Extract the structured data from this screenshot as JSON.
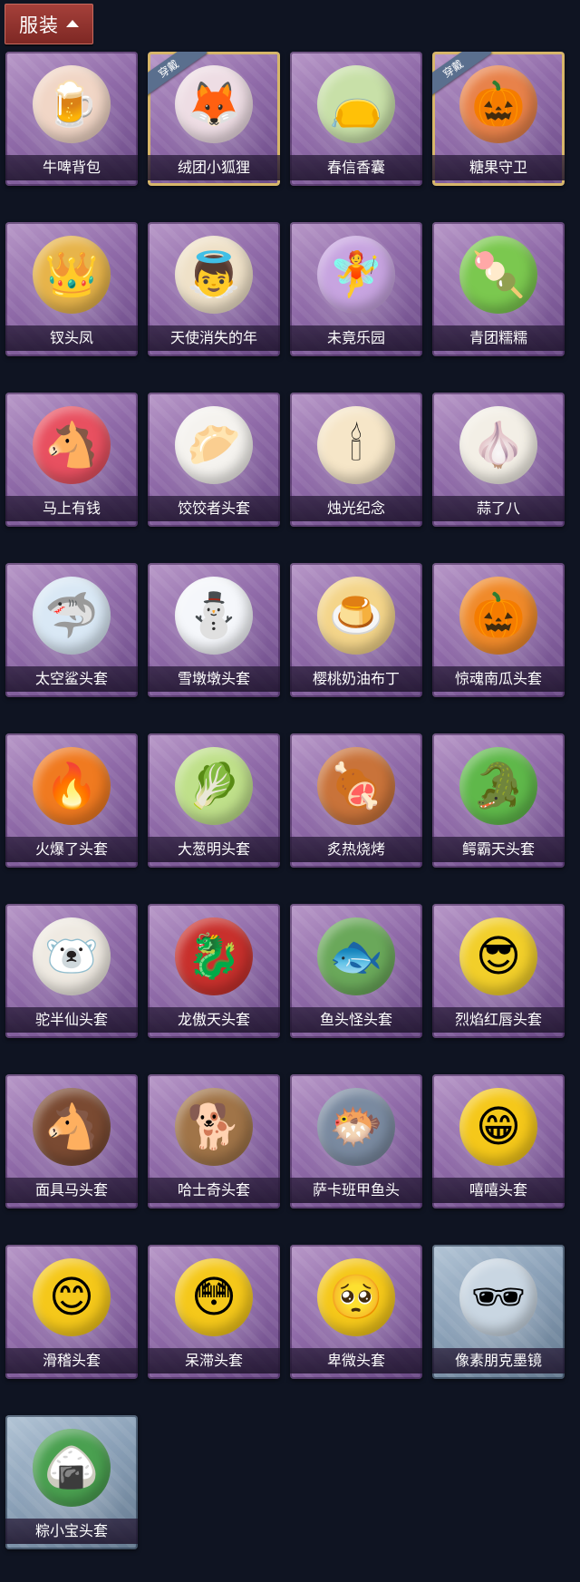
{
  "header": {
    "label": "服装"
  },
  "equipped_badge": "穿戴",
  "items": [
    {
      "name": "牛啤背包",
      "icon": "🍺",
      "icon_name": "cow-beer-backpack-icon",
      "bg": "#f1d6c6",
      "theme": "purple",
      "equipped": false
    },
    {
      "name": "绒团小狐狸",
      "icon": "🦊",
      "icon_name": "fox-plush-icon",
      "bg": "#eedde4",
      "theme": "purple",
      "equipped": true
    },
    {
      "name": "春信香囊",
      "icon": "👝",
      "icon_name": "sachet-icon",
      "bg": "#c8e0a8",
      "theme": "purple",
      "equipped": false
    },
    {
      "name": "糖果守卫",
      "icon": "🎃",
      "icon_name": "candy-guard-icon",
      "bg": "#e8824a",
      "theme": "purple",
      "equipped": true
    },
    {
      "name": "钗头凤",
      "icon": "👑",
      "icon_name": "phoenix-crown-icon",
      "bg": "#e7b44a",
      "theme": "purple",
      "equipped": false
    },
    {
      "name": "天使消失的年",
      "icon": "👼",
      "icon_name": "angel-doll-icon",
      "bg": "#efe1c8",
      "theme": "purple",
      "equipped": false
    },
    {
      "name": "未竟乐园",
      "icon": "🧚",
      "icon_name": "fairy-doll-icon",
      "bg": "#c7a4e0",
      "theme": "purple",
      "equipped": false
    },
    {
      "name": "青团糯糯",
      "icon": "🍡",
      "icon_name": "green-dumpling-icon",
      "bg": "#7bc84f",
      "theme": "purple",
      "equipped": false
    },
    {
      "name": "马上有钱",
      "icon": "🐴",
      "icon_name": "red-horse-icon",
      "bg": "#e85060",
      "theme": "purple",
      "equipped": false
    },
    {
      "name": "饺饺者头套",
      "icon": "🥟",
      "icon_name": "dumpling-head-icon",
      "bg": "#f5f3ef",
      "theme": "purple",
      "equipped": false
    },
    {
      "name": "烛光纪念",
      "icon": "🕯",
      "icon_name": "candle-head-icon",
      "bg": "#f6e6c8",
      "theme": "purple",
      "equipped": false
    },
    {
      "name": "蒜了八",
      "icon": "🧄",
      "icon_name": "garlic-head-icon",
      "bg": "#f3efe6",
      "theme": "purple",
      "equipped": false
    },
    {
      "name": "太空鲨头套",
      "icon": "🦈",
      "icon_name": "space-shark-head-icon",
      "bg": "#d9e8f5",
      "theme": "purple",
      "equipped": false
    },
    {
      "name": "雪墩墩头套",
      "icon": "⛄",
      "icon_name": "snowman-head-icon",
      "bg": "#f5f7fb",
      "theme": "purple",
      "equipped": false
    },
    {
      "name": "樱桃奶油布丁",
      "icon": "🍮",
      "icon_name": "pudding-head-icon",
      "bg": "#f4d58a",
      "theme": "purple",
      "equipped": false
    },
    {
      "name": "惊魂南瓜头套",
      "icon": "🎃",
      "icon_name": "pumpkin-head-icon",
      "bg": "#f08a2a",
      "theme": "purple",
      "equipped": false
    },
    {
      "name": "火爆了头套",
      "icon": "🔥",
      "icon_name": "fire-head-icon",
      "bg": "#f07a20",
      "theme": "purple",
      "equipped": false
    },
    {
      "name": "大葱明头套",
      "icon": "🥬",
      "icon_name": "scallion-head-icon",
      "bg": "#bfe08a",
      "theme": "purple",
      "equipped": false
    },
    {
      "name": "炙热烧烤",
      "icon": "🍖",
      "icon_name": "bbq-meat-head-icon",
      "bg": "#c9733a",
      "theme": "purple",
      "equipped": false
    },
    {
      "name": "鳄霸天头套",
      "icon": "🐊",
      "icon_name": "crocodile-head-icon",
      "bg": "#5fb84a",
      "theme": "purple",
      "equipped": false
    },
    {
      "name": "驼半仙头套",
      "icon": "🐻‍❄️",
      "icon_name": "alpaca-sunglasses-head-icon",
      "bg": "#efeae2",
      "theme": "purple",
      "equipped": false
    },
    {
      "name": "龙傲天头套",
      "icon": "🐉",
      "icon_name": "dragon-head-icon",
      "bg": "#c8302c",
      "theme": "purple",
      "equipped": false
    },
    {
      "name": "鱼头怪头套",
      "icon": "🐟",
      "icon_name": "fish-head-icon",
      "bg": "#6aa85a",
      "theme": "purple",
      "equipped": false
    },
    {
      "name": "烈焰红唇头套",
      "icon": "😎",
      "icon_name": "yellow-mouse-head-icon",
      "bg": "#f2cf2a",
      "theme": "purple",
      "equipped": false
    },
    {
      "name": "面具马头套",
      "icon": "🐴",
      "icon_name": "horse-mask-icon",
      "bg": "#7a4a32",
      "theme": "purple",
      "equipped": false
    },
    {
      "name": "哈士奇头套",
      "icon": "🐕",
      "icon_name": "husky-head-icon",
      "bg": "#a07448",
      "theme": "purple",
      "equipped": false
    },
    {
      "name": "萨卡班甲鱼头",
      "icon": "🐡",
      "icon_name": "sacabambaspis-head-icon",
      "bg": "#7a8aa0",
      "theme": "purple",
      "equipped": false
    },
    {
      "name": "嘻嘻头套",
      "icon": "😁",
      "icon_name": "grin-emoji-head-icon",
      "bg": "#f5c81a",
      "theme": "purple",
      "equipped": false
    },
    {
      "name": "滑稽头套",
      "icon": "😊",
      "icon_name": "funny-emoji-head-icon",
      "bg": "#f5c81a",
      "theme": "purple",
      "equipped": false
    },
    {
      "name": "呆滞头套",
      "icon": "😳",
      "icon_name": "dazed-emoji-head-icon",
      "bg": "#f5c81a",
      "theme": "purple",
      "equipped": false
    },
    {
      "name": "卑微头套",
      "icon": "🥺",
      "icon_name": "humble-emoji-head-icon",
      "bg": "#f5c81a",
      "theme": "purple",
      "equipped": false
    },
    {
      "name": "像素朋克墨镜",
      "icon": "🕶",
      "icon_name": "pixel-sunglasses-icon",
      "bg": "#c9d6e2",
      "theme": "blue",
      "equipped": false
    },
    {
      "name": "粽小宝头套",
      "icon": "🍙",
      "icon_name": "zongzi-head-icon",
      "bg": "#4aa050",
      "theme": "blue",
      "equipped": false
    }
  ]
}
